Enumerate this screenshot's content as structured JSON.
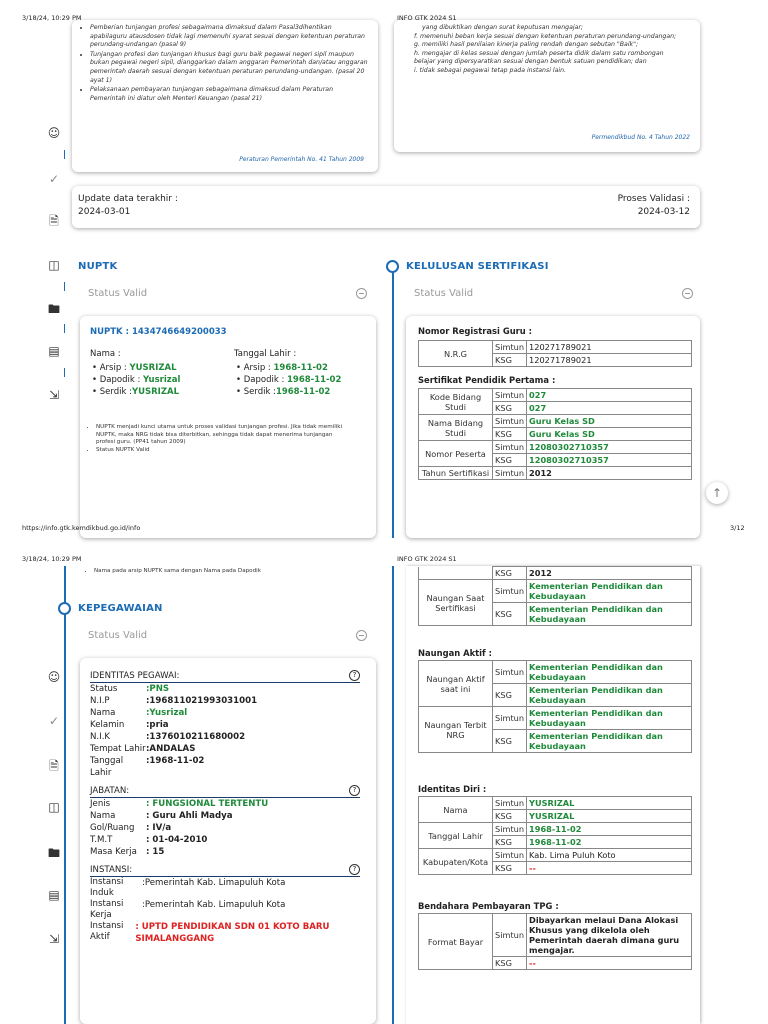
{
  "print": {
    "p1_datetime": "3/18/24, 10:29 PM",
    "p1_title": "INFO GTK 2024 S1",
    "p1_url": "https://info.gtk.kemdikbud.go.id/info",
    "p1_pagenum": "3/12",
    "p2_datetime": "3/18/24, 10:29 PM",
    "p2_title": "INFO GTK 2024 S1"
  },
  "top": {
    "left_bullets": [
      "Pemberian tunjangan profesi sebagaimana dimaksud dalam Pasal3dihentikan apabilaguru atausdosen tidak lagi memenuhi syarat sesuai dengan ketentuan peraturan perundang-undangan (pasal 9)",
      "Tunjangan profesi dan tunjangan khusus bagi guru baik pegawai negeri sipil maupun bukan pegawai negeri sipil, dianggarkan dalam anggaran Pemerintah dan/atau anggaran pemerintah daerah sesuai dengan ketentuan peraturan perundang-undangan. (pasal 20 ayat 1)",
      "Pelaksanaan pembayaran tunjangan sebagaimana dimaksud dalam Peraturan Pemerintah ini diatur oleh Menteri Keuangan (pasal 21)"
    ],
    "left_ref": "Peraturan Pemerintah No. 41 Tahun 2009",
    "right_items": [
      "yang dibuktikan dengan surat keputusan mengajar;",
      "f. memenuhi beban kerja sesuai dengan ketentuan peraturan perundang-undangan;",
      "g. memiliki hasil penilaian kinerja paling rendah dengan sebutan \"Baik\";",
      "h. mengajar di kelas sesuai dengan jumlah peserta didik dalam satu rombongan belajar yang dipersyaratkan sesuai dengan bentuk satuan pendidikan; dan",
      "i. tidak sebagai pegawai tetap pada instansi lain."
    ],
    "right_ref": "Permendikbud No. 4 Tahun 2022"
  },
  "update": {
    "left_label": "Update data terakhir :",
    "left_value": "2024-03-01",
    "right_label": "Proses Validasi :",
    "right_value": "2024-03-12"
  },
  "nuptk": {
    "section_title": "NUPTK",
    "status": "Status Valid",
    "header": "NUPTK : 1434746649200033",
    "nama_label": "Nama :",
    "tgl_label": "Tanggal Lahir :",
    "nama": [
      {
        "src": "Arsip : ",
        "val": "YUSRIZAL"
      },
      {
        "src": "Dapodik : ",
        "val": "Yusrizal"
      },
      {
        "src": "Serdik :",
        "val": "YUSRIZAL"
      }
    ],
    "tgl": [
      {
        "src": "Arsip : ",
        "val": "1968-11-02"
      },
      {
        "src": "Dapodik : ",
        "val": "1968-11-02"
      },
      {
        "src": "Serdik :",
        "val": "1968-11-02"
      }
    ],
    "notes": [
      "NUPTK menjadi kunci utama untuk proses validasi tunjangan profesi. Jika tidak memiliki NUPTK, maka NRG tidak bisa diterbitkan, sehingga tidak dapat menerima tunjangan profesi guru. (PP41 tahun 2009)",
      "Status NUPTK Valid"
    ],
    "note_p2": "Nama pada arsip NUPTK sama dengan Nama pada Dapodik"
  },
  "sertifikasi": {
    "section_title": "KELULUSAN SERTIFIKASI",
    "status": "Status Valid",
    "reg_title": "Nomor Registrasi Guru :",
    "nrg_label": "N.R.G",
    "simtun": "Simtun",
    "ksg": "KSG",
    "nrg_simtun": "120271789021",
    "nrg_ksg": "120271789021",
    "sert_title": "Sertifikat Pendidik Pertama :",
    "kode_label": "Kode Bidang Studi",
    "kode_simtun": "027",
    "kode_ksg": "027",
    "nama_label": "Nama Bidang Studi",
    "nama_simtun": "Guru Kelas SD",
    "nama_ksg": "Guru Kelas SD",
    "peserta_label": "Nomor Peserta",
    "peserta_simtun": "12080302710357",
    "peserta_ksg": "12080302710357",
    "tahun_label": "Tahun Sertifikasi",
    "tahun_simtun": "2012",
    "tahun_ksg": "2012",
    "naungan_sert_label": "Naungan Saat Sertifikasi",
    "kemdikbud": "Kementerian Pendidikan dan Kebudayaan",
    "aktif_title": "Naungan Aktif :",
    "naungan_aktif_label": "Naungan Aktif saat ini",
    "naungan_nrg_label": "Naungan Terbit NRG",
    "diri_title": "Identitas Diri :",
    "diri_nama_label": "Nama",
    "diri_nama_simtun": "YUSRIZAL",
    "diri_nama_ksg": "YUSRIZAL",
    "diri_tgl_label": "Tanggal Lahir",
    "diri_tgl_simtun": "1968-11-02",
    "diri_tgl_ksg": "1968-11-02",
    "kab_label": "Kabupaten/Kota",
    "kab_simtun": "Kab. Lima Puluh Koto",
    "kab_ksg": "--",
    "bend_title": "Bendahara Pembayaran TPG :",
    "format_label": "Format Bayar",
    "format_simtun": "Dibayarkan melaui Dana Alokasi Khusus yang dikelola oleh Pemerintah daerah dimana guru mengajar.",
    "format_ksg": "--"
  },
  "kepegawaian": {
    "section_title": "KEPEGAWAIAN",
    "status": "Status Valid",
    "identitas_title": "IDENTITAS PEGAWAI:",
    "identitas": [
      {
        "k": "Status",
        "v": ":PNS",
        "cls": "green"
      },
      {
        "k": "N.I.P",
        "v": ":196811021993031001",
        "cls": "val"
      },
      {
        "k": "Nama",
        "v": ":Yusrizal",
        "cls": "green"
      },
      {
        "k": "Kelamin",
        "v": ":pria",
        "cls": "val"
      },
      {
        "k": "N.I.K",
        "v": ":1376010211680002",
        "cls": "val"
      },
      {
        "k": "Tempat Lahir",
        "v": ":ANDALAS",
        "cls": "val"
      },
      {
        "k": "Tanggal Lahir",
        "v": ":1968-11-02",
        "cls": "val"
      }
    ],
    "jabatan_title": "JABATAN:",
    "jabatan": [
      {
        "k": "Jenis",
        "v": ": FUNGSIONAL TERTENTU",
        "cls": "green"
      },
      {
        "k": "Nama",
        "v": ": Guru Ahli Madya",
        "cls": "val"
      },
      {
        "k": "Gol/Ruang",
        "v": ": IV/a",
        "cls": "val"
      },
      {
        "k": "T.M.T",
        "v": ": 01-04-2010",
        "cls": "val"
      },
      {
        "k": "Masa Kerja",
        "v": ": 15",
        "cls": "val"
      }
    ],
    "instansi_title": "INSTANSI:",
    "instansi": [
      {
        "k": "Instansi Induk",
        "v": ":Pemerintah Kab. Limapuluh Kota",
        "cls": ""
      },
      {
        "k": "Instansi Kerja",
        "v": ":Pemerintah Kab. Limapuluh Kota",
        "cls": ""
      },
      {
        "k": "Instansi Aktif",
        "v": ": UPTD PENDIDIKAN SDN 01 KOTO BARU SIMALANGGANG",
        "cls": "red"
      }
    ],
    "help": "?"
  },
  "icons": {
    "user": "user-icon",
    "check": "check-icon",
    "doc": "document-icon",
    "book": "book-icon",
    "folder": "folder-icon",
    "inbox": "inbox-icon",
    "logout": "logout-icon",
    "scroll_top": "arrow-up-icon"
  }
}
